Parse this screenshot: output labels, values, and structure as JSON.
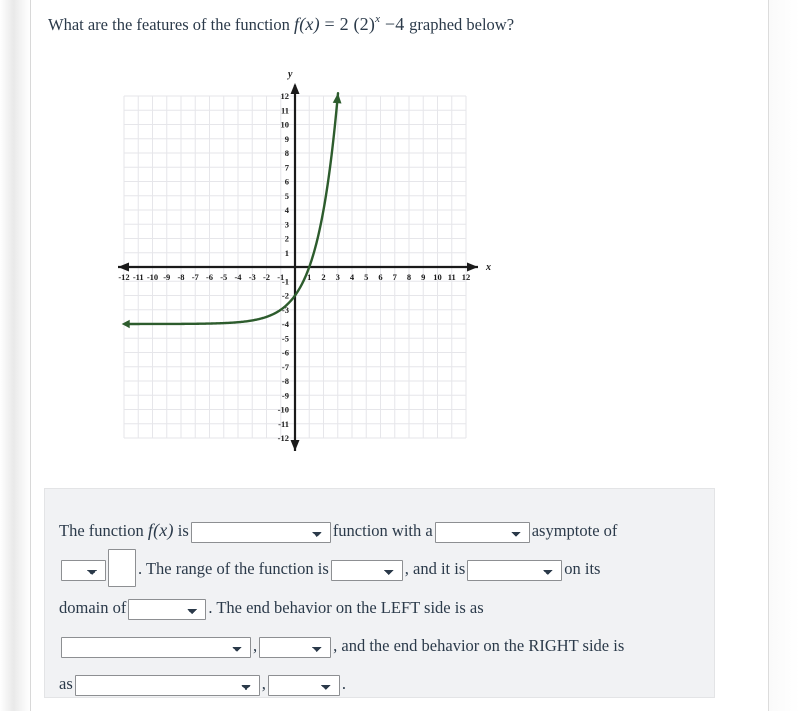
{
  "question": {
    "prefix": "What are the features of the function",
    "formula": {
      "lhs": "f(x)",
      "equals": "=",
      "coefficient": "2",
      "base": "(2)",
      "exponent": "x",
      "minus": "−",
      "constant": "4",
      "plain": "f(x) = 2(2)^x - 4"
    },
    "suffix": "graphed below?"
  },
  "graph": {
    "axis_labels": {
      "x": "x",
      "y": "y"
    },
    "x_ticks": [
      "-12",
      "-11",
      "-10",
      "-9",
      "-8",
      "-7",
      "-6",
      "-5",
      "-4",
      "-3",
      "-2",
      "-1",
      "1",
      "2",
      "3",
      "4",
      "5",
      "6",
      "7",
      "8",
      "9",
      "10",
      "11",
      "12"
    ],
    "y_ticks": [
      "12",
      "11",
      "10",
      "9",
      "8",
      "7",
      "6",
      "5",
      "4",
      "3",
      "2",
      "1",
      "-1",
      "-2",
      "-3",
      "-4",
      "-5",
      "-6",
      "-7",
      "-8",
      "-9",
      "-10",
      "-11",
      "-12"
    ],
    "curve_color": "#2d5c2d",
    "axis_color": "#1a1a1a",
    "grid_color": "#e6e6ea"
  },
  "chart_data": {
    "type": "line",
    "title": "",
    "xlabel": "x",
    "ylabel": "y",
    "xlim": [
      -12,
      12
    ],
    "ylim": [
      -12,
      12
    ],
    "grid": true,
    "legend": "none",
    "series": [
      {
        "name": "f(x) = 2(2)^x - 4",
        "color": "#2d5c2d",
        "asymptote": -4,
        "y_intercept": -2,
        "x_intercept": 1,
        "x": [
          -12,
          -10,
          -8,
          -6,
          -5,
          -4,
          -3,
          -2,
          -1,
          0,
          1,
          2,
          3
        ],
        "y": [
          -4.0,
          -4.0,
          -3.99,
          -3.97,
          -3.94,
          -3.88,
          -3.75,
          -3.5,
          -3.0,
          -2.0,
          0.0,
          4.0,
          12.0
        ]
      }
    ]
  },
  "answer": {
    "line1_a": "The function",
    "line1_math": "f(x)",
    "line1_b": "is",
    "line1_c": "function with a",
    "line1_d": "asymptote of",
    "line2_a": ". The range of the function is",
    "line2_b": ", and it is",
    "line2_c": "on its",
    "line3_a": "domain of",
    "line3_b": ". The end behavior on the LEFT side is as",
    "line4_a": ",",
    "line4_b": ", and the end behavior on the RIGHT side is",
    "line5_a": "as",
    "line5_b": ",",
    "line5_c": ".",
    "selects": {
      "function_type": "",
      "asymptote_type": "",
      "asymptote_axis": "",
      "asymptote_value": "",
      "range": "",
      "monotonicity": "",
      "domain": "",
      "left_x": "",
      "left_y": "",
      "right_x": "",
      "right_y": ""
    }
  }
}
